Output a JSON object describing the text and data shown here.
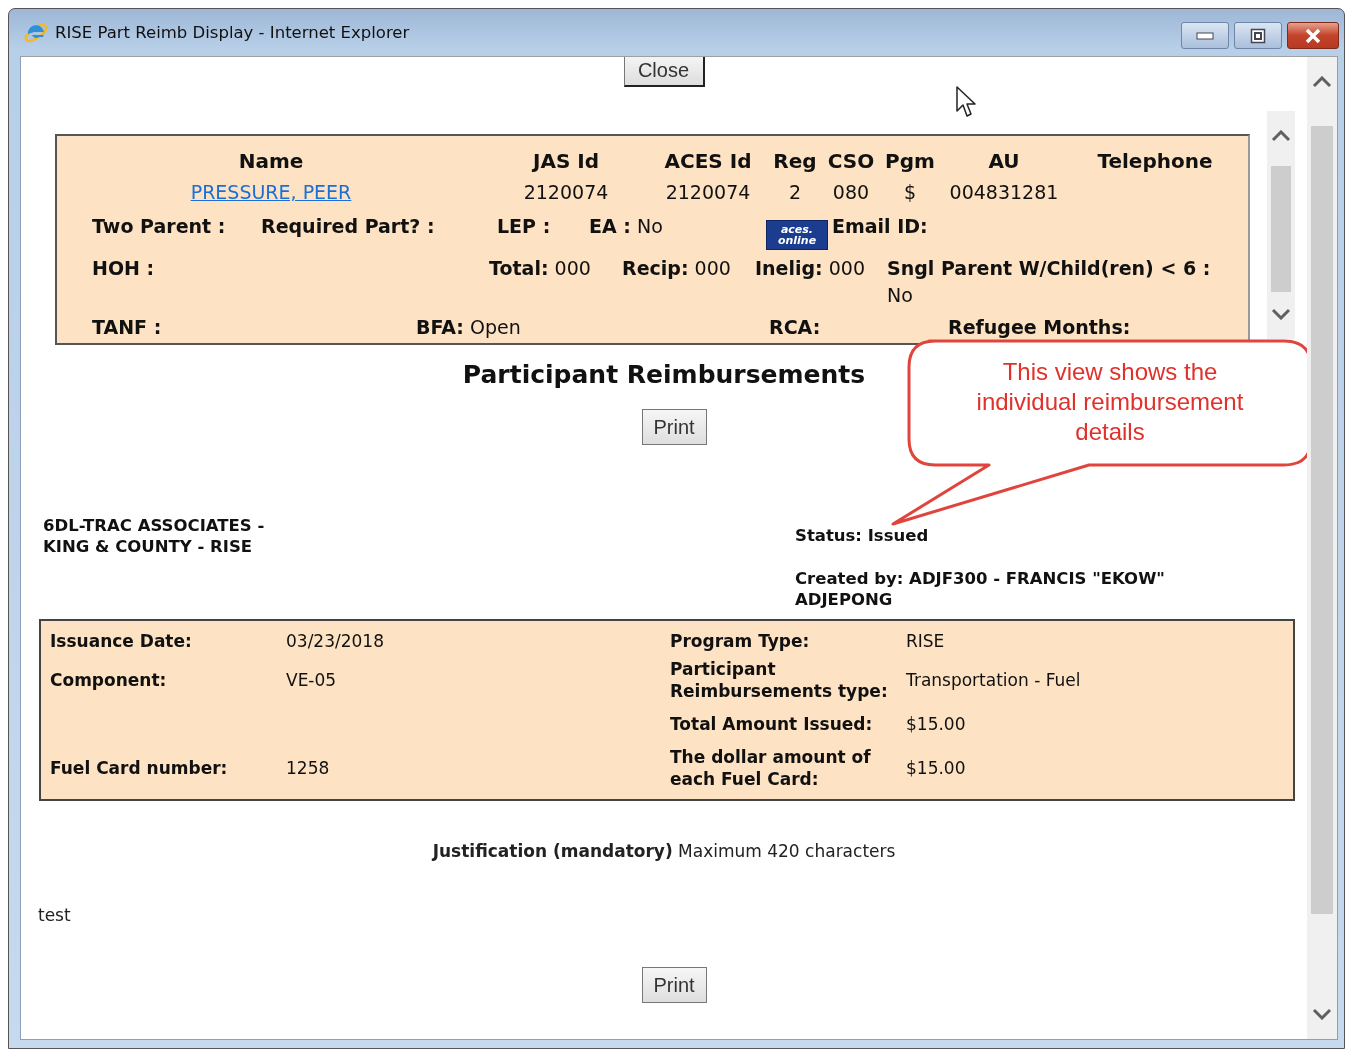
{
  "window": {
    "title": "RISE Part Reimb Display - Internet Explorer"
  },
  "close_button": "Close",
  "participant": {
    "columns": [
      {
        "label": "Name",
        "value": "PRESSURE, PEER",
        "kind": "link"
      },
      {
        "label": "JAS Id",
        "value": "2120074",
        "kind": "text"
      },
      {
        "label": "ACES Id",
        "value": "2120074",
        "kind": "text"
      },
      {
        "label": "Reg",
        "value": "2",
        "kind": "text"
      },
      {
        "label": "CSO",
        "value": "080",
        "kind": "text"
      },
      {
        "label": "Pgm",
        "value": "$",
        "kind": "text"
      },
      {
        "label": "AU",
        "value": "004831281",
        "kind": "text"
      },
      {
        "label": "Telephone"
      }
    ],
    "info_lines": [
      [
        {
          "kind": "field",
          "label": "Two Parent :"
        },
        {
          "kind": "field",
          "label": "Required Part? :"
        },
        {
          "kind": "field",
          "label": "LEP :"
        },
        {
          "kind": "field",
          "label": "EA :",
          "value": "No"
        },
        {
          "kind": "logo",
          "lines": [
            "aces.",
            "online"
          ]
        },
        {
          "kind": "field",
          "label": "Email ID:"
        }
      ],
      [
        {
          "kind": "field",
          "label": "HOH :"
        },
        {
          "kind": "field",
          "label": "Total:",
          "value": "000"
        },
        {
          "kind": "field",
          "label": "Recip:",
          "value": "000"
        },
        {
          "kind": "field",
          "label": "Inelig:",
          "value": "000"
        },
        {
          "kind": "field",
          "label": "Sngl Parent W/Child(ren) < 6 :",
          "value": "No"
        }
      ],
      [
        {
          "kind": "field",
          "label": "TANF :"
        },
        {
          "kind": "field",
          "label": "BFA:",
          "value": "Open"
        },
        {
          "kind": "field",
          "label": "RCA:"
        },
        {
          "kind": "field",
          "label": "Refugee Months:"
        }
      ]
    ]
  },
  "heading": "Participant Reimbursements",
  "top_print_button": "Print",
  "callout": "This view shows the individual reimbursement details",
  "provider": "6DL-TRAC ASSOCIATES - KING & COUNTY - RISE",
  "status": {
    "label": "Status:",
    "value": "Issued"
  },
  "created_by": {
    "label": "Created by:",
    "value": "ADJF300 - FRANCIS \"EKOW\" ADJEPONG"
  },
  "details": {
    "rows": [
      {
        "left": {
          "label": "Issuance Date:",
          "value": "03/23/2018"
        },
        "right": {
          "label": "Program Type:",
          "value": "RISE"
        }
      },
      {
        "left": {
          "label": "Component:",
          "value": "VE-05"
        },
        "right": {
          "label": "Participant Reimbursements type:",
          "value": "Transportation - Fuel"
        }
      },
      {
        "right": {
          "label": "Total Amount Issued:",
          "value": "$15.00"
        }
      },
      {
        "left": {
          "label": "Fuel Card number:",
          "value": "1258"
        },
        "right": {
          "label": "The dollar amount of each Fuel Card:",
          "value": "$15.00"
        }
      }
    ]
  },
  "justification_prompt": "**Justification (mandatory)** Maximum 420 characters",
  "justification_text": "test",
  "bottom_print_button": "Print"
}
